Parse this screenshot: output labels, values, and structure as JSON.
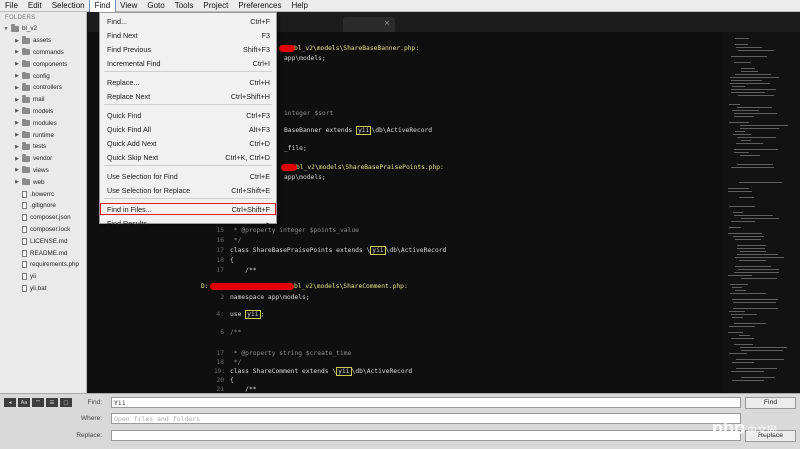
{
  "menubar": [
    "File",
    "Edit",
    "Selection",
    "Find",
    "View",
    "Goto",
    "Tools",
    "Project",
    "Preferences",
    "Help"
  ],
  "sidebar": {
    "header": "FOLDERS",
    "items": [
      {
        "label": "bl_v2",
        "type": "folder",
        "depth": 0
      },
      {
        "label": "assets",
        "type": "folder",
        "depth": 1
      },
      {
        "label": "commands",
        "type": "folder",
        "depth": 1
      },
      {
        "label": "components",
        "type": "folder",
        "depth": 1
      },
      {
        "label": "config",
        "type": "folder",
        "depth": 1
      },
      {
        "label": "controllers",
        "type": "folder",
        "depth": 1
      },
      {
        "label": "mail",
        "type": "folder",
        "depth": 1
      },
      {
        "label": "models",
        "type": "folder",
        "depth": 1
      },
      {
        "label": "modules",
        "type": "folder",
        "depth": 1
      },
      {
        "label": "runtime",
        "type": "folder",
        "depth": 1
      },
      {
        "label": "tests",
        "type": "folder",
        "depth": 1
      },
      {
        "label": "vendor",
        "type": "folder",
        "depth": 1
      },
      {
        "label": "views",
        "type": "folder",
        "depth": 1
      },
      {
        "label": "web",
        "type": "folder",
        "depth": 1
      },
      {
        "label": ".bowerrc",
        "type": "file",
        "depth": 1
      },
      {
        "label": ".gitignore",
        "type": "file",
        "depth": 1
      },
      {
        "label": "composer.json",
        "type": "file",
        "depth": 1
      },
      {
        "label": "composer.lock",
        "type": "file",
        "depth": 1
      },
      {
        "label": "LICENSE.md",
        "type": "file",
        "depth": 1
      },
      {
        "label": "README.md",
        "type": "file",
        "depth": 1
      },
      {
        "label": "requirements.php",
        "type": "file",
        "depth": 1
      },
      {
        "label": "yii",
        "type": "file",
        "depth": 1
      },
      {
        "label": "yii.bat",
        "type": "file",
        "depth": 1
      }
    ]
  },
  "tab": {
    "close": "×"
  },
  "find_menu": {
    "items": [
      {
        "label": "Find...",
        "shortcut": "Ctrl+F"
      },
      {
        "label": "Find Next",
        "shortcut": "F3"
      },
      {
        "label": "Find Previous",
        "shortcut": "Shift+F3"
      },
      {
        "label": "Incremental Find",
        "shortcut": "Ctrl+I"
      },
      {
        "label": "Replace...",
        "shortcut": "Ctrl+H"
      },
      {
        "label": "Replace Next",
        "shortcut": "Ctrl+Shift+H"
      },
      {
        "label": "Quick Find",
        "shortcut": "Ctrl+F3"
      },
      {
        "label": "Quick Find All",
        "shortcut": "Alt+F3"
      },
      {
        "label": "Quick Add Next",
        "shortcut": "Ctrl+D"
      },
      {
        "label": "Quick Skip Next",
        "shortcut": "Ctrl+K, Ctrl+D"
      },
      {
        "label": "Use Selection for Find",
        "shortcut": "Ctrl+E"
      },
      {
        "label": "Use Selection for Replace",
        "shortcut": "Ctrl+Shift+E"
      },
      {
        "label": "Find in Files...",
        "shortcut": "Ctrl+Shift+F"
      },
      {
        "label": "Find Results",
        "shortcut": "▸"
      }
    ]
  },
  "code": {
    "l01": "bl_v2\\models\\ShareBaseBanner.php:",
    "l02": "app\\models;",
    "l03": "integer $sort",
    "l04": "BaseBanner extends ",
    "l04b": "yii",
    "l04c": "\\db\\ActiveRecord",
    "l05": "_file;",
    "l06": "bl_v2\\models\\ShareBasePraisePoints.php:",
    "l07": "app\\models;",
    "l08n": "15",
    "l08": " * @property integer $points_value",
    "l09n": "16",
    "l09": " */",
    "l10n": "17",
    "l10": "class ShareBasePraisePoints extends \\",
    "l10b": "yii",
    "l10c": "\\db\\ActiveRecord",
    "l11n": "18",
    "l11": "{",
    "l12n": "17",
    "l12": "    /**",
    "l13a": "D:",
    "l13": "bl_v2\\models\\ShareComment.php:",
    "l14n": "2",
    "l14": "namespace app\\models;",
    "l15n": "4:",
    "l15": "use ",
    "l15b": "yii",
    "l15c": ";",
    "l16n": "6",
    "l16": "/**",
    "l17n": "17",
    "l17": " * @property string $create_time",
    "l18n": "18",
    "l18": " */",
    "l19n": "19:",
    "l19": "class ShareComment extends \\",
    "l19b": "yii",
    "l19c": "\\db\\ActiveRecord",
    "l20n": "20",
    "l20": "{",
    "l21n": "21",
    "l21": "    /**"
  },
  "find_panel": {
    "options": [
      "◂",
      "Aa",
      "\"\"",
      "☰",
      "▢"
    ],
    "find_label": "Find:",
    "find_value": "Yii",
    "where_label": "Where:",
    "where_placeholder": "Open files and folders",
    "replace_label": "Replace:",
    "find_button": "Find",
    "replace_button": "Replace",
    "watermark": "php",
    "watermark_cn": "中文网"
  },
  "colors": {
    "menu_highlight_box": "#e11b1b",
    "redaction": "#e30000"
  }
}
